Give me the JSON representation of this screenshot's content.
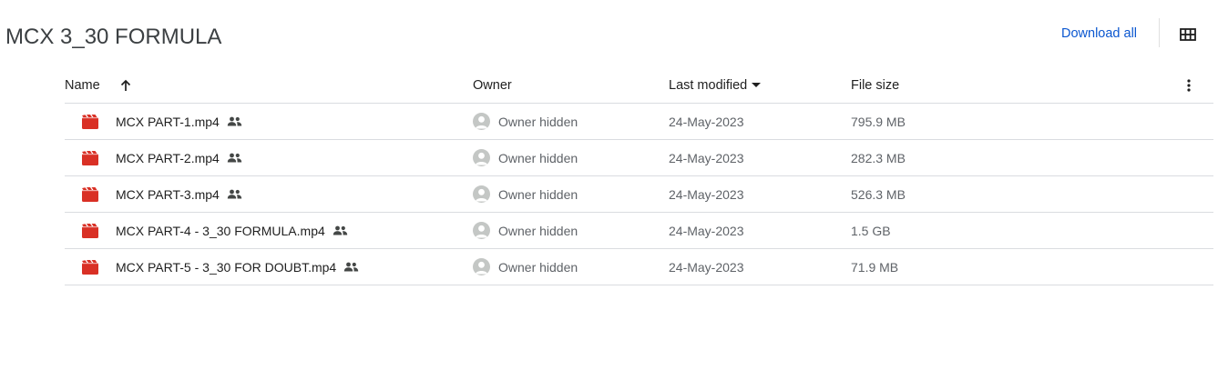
{
  "folder": {
    "title": "MCX 3_30 FORMULA"
  },
  "header": {
    "download_all_label": "Download all",
    "grid_view_icon": "grid-view-icon"
  },
  "table": {
    "columns": {
      "name": "Name",
      "owner": "Owner",
      "last_modified": "Last modified",
      "file_size": "File size"
    },
    "rows": [
      {
        "name": "MCX PART-1.mp4",
        "owner": "Owner hidden",
        "modified": "24-May-2023",
        "size": "795.9 MB"
      },
      {
        "name": "MCX PART-2.mp4",
        "owner": "Owner hidden",
        "modified": "24-May-2023",
        "size": "282.3 MB"
      },
      {
        "name": "MCX PART-3.mp4",
        "owner": "Owner hidden",
        "modified": "24-May-2023",
        "size": "526.3 MB"
      },
      {
        "name": "MCX PART-4 - 3_30 FORMULA.mp4",
        "owner": "Owner hidden",
        "modified": "24-May-2023",
        "size": "1.5 GB"
      },
      {
        "name": "MCX PART-5 - 3_30 FOR DOUBT.mp4",
        "owner": "Owner hidden",
        "modified": "24-May-2023",
        "size": "71.9 MB"
      }
    ]
  },
  "colors": {
    "accent": "#0b57d0",
    "video_icon": "#d93025",
    "divider": "#dadce0"
  }
}
